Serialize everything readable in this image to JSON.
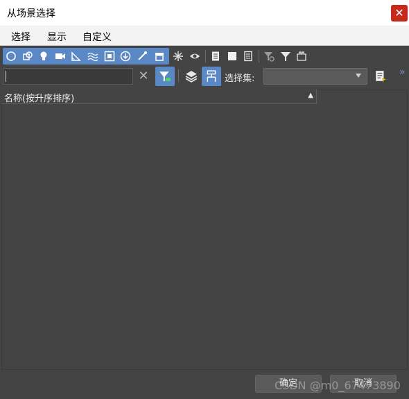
{
  "window": {
    "title": "从场景选择",
    "close_glyph": "✕"
  },
  "menu": {
    "items": [
      "选择",
      "显示",
      "自定义"
    ]
  },
  "toolbar": {
    "filter_icons": [
      "geometry-icon",
      "shapes-icon",
      "lights-icon",
      "cameras-icon",
      "helpers-icon",
      "spacewarps-icon",
      "groups-icon",
      "xrefs-icon",
      "bones-icon",
      "containers-icon"
    ],
    "display_icons": [
      "frozen-icon",
      "hidden-icon"
    ],
    "list_icons": [
      "list-all-icon",
      "list-none-icon",
      "list-invert-icon"
    ],
    "filter_toggle_icons": [
      "filter-settings-icon",
      "filter-icon",
      "filter-combo-icon"
    ]
  },
  "search": {
    "value": "",
    "placeholder": ""
  },
  "selection_set": {
    "label": "选择集:",
    "value": ""
  },
  "list": {
    "column_header": "名称(按升序排序)",
    "sort_glyph": "▲"
  },
  "footer": {
    "ok": "确定",
    "cancel": "取消"
  },
  "watermark": "CSDN @m0_67473890",
  "colors": {
    "accent": "#5a88c4",
    "close": "#c42b1c",
    "panel": "#444444"
  }
}
